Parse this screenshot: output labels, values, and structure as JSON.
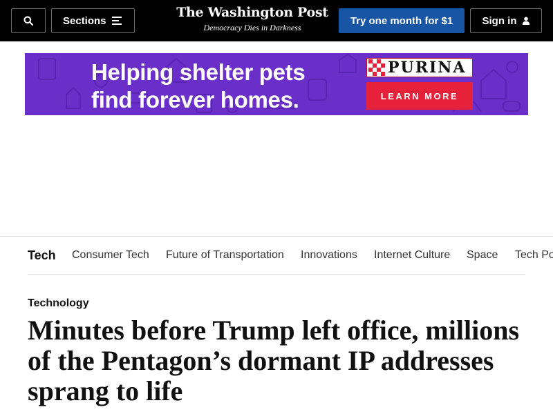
{
  "header": {
    "search_icon": "search-icon",
    "sections_label": "Sections",
    "sections_icon": "menu-lines-icon",
    "logo_text": "The Washington Post",
    "tagline": "Democracy Dies in Darkness",
    "subscribe_label": "Try one month for $1",
    "signin_label": "Sign in",
    "signin_icon": "user-icon",
    "colors": {
      "bar": "#000000",
      "subscribe_bg": "#1955a5"
    }
  },
  "ad": {
    "headline_line1": "Helping shelter pets",
    "headline_line2": "find forever homes.",
    "brand": "PURINA",
    "cta": "LEARN MORE",
    "colors": {
      "background": "#6a2ec9",
      "cta": "#e8213a",
      "brand_red": "#e8213a"
    }
  },
  "section_nav": {
    "main": "Tech",
    "items": [
      "Consumer Tech",
      "Future of Transportation",
      "Innovations",
      "Internet Culture",
      "Space",
      "Tech Policy"
    ]
  },
  "article": {
    "kicker": "Technology",
    "headline": "Minutes before Trump left office, millions of the Pentagon’s dormant IP addresses sprang to life"
  }
}
